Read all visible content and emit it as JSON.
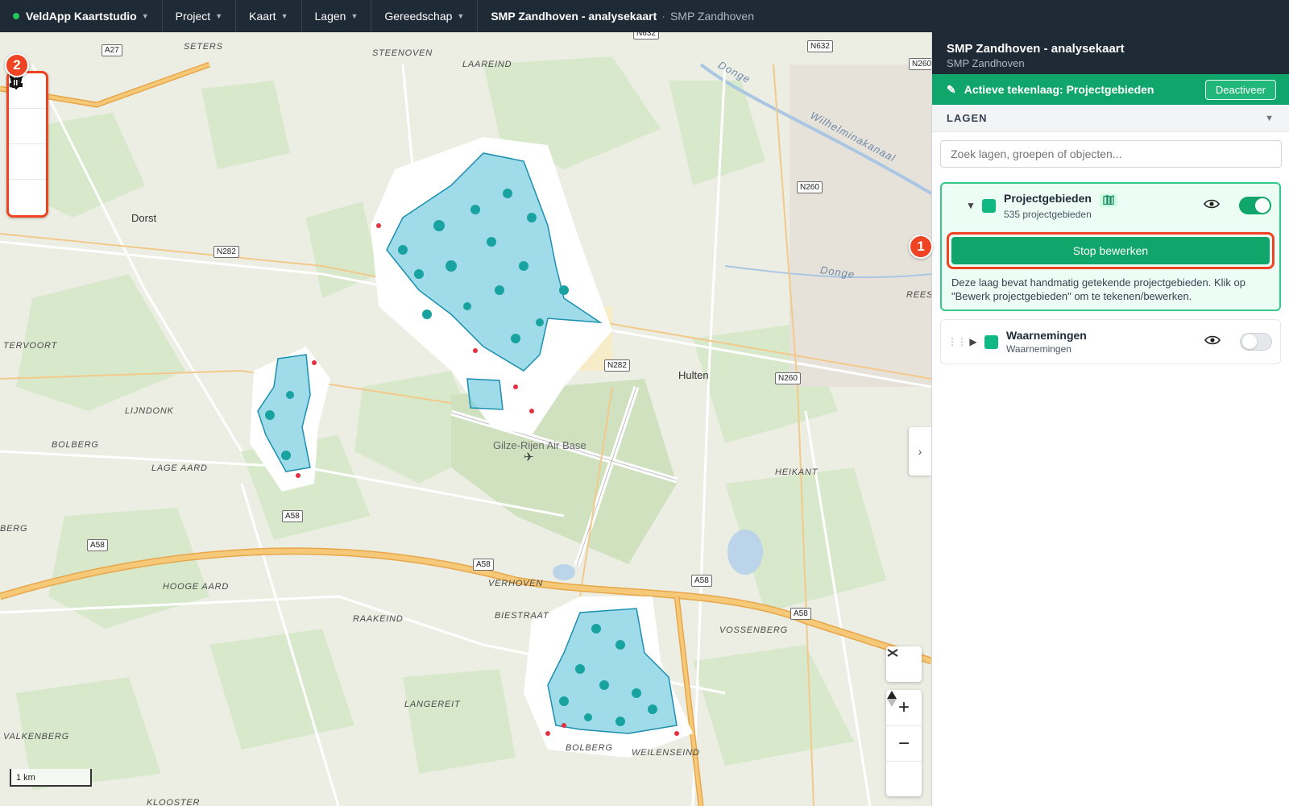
{
  "topbar": {
    "brand": "VeldApp Kaartstudio",
    "menus": [
      "Project",
      "Kaart",
      "Lagen",
      "Gereedschap"
    ],
    "crumb_title": "SMP Zandhoven - analysekaart",
    "crumb_sep": "·",
    "crumb_sub": "SMP Zandhoven"
  },
  "map": {
    "labels": {
      "seters": "SETERS",
      "steenoven": "STEENOVEN",
      "laareind": "LAAREIND",
      "dorst": "Dorst",
      "tervoort": "TERVOORT",
      "lijndonk": "LIJNDONK",
      "bolberg_w": "BOLBERG",
      "lage_aard": "LAGE AARD",
      "berg": "BERG",
      "hooge_aard": "HOOGE AARD",
      "raakeind": "RAAKEIND",
      "verhoven": "VERHOVEN",
      "biestraat": "BIESTRAAT",
      "langereit": "LANGEREIT",
      "valkenberg": "VALKENBERG",
      "klooster": "KLOOSTER",
      "bolberg_s": "BOLBERG",
      "weilenseind": "WEILENSEIND",
      "hulten": "Hulten",
      "heikant": "HEIKANT",
      "vossenberg": "VOSSENBERG",
      "reesi": "REESI",
      "airbase": "Gilze-Rijen Air Base",
      "donge1": "Donge",
      "donge2": "Donge",
      "wilhelmina": "Wilhelminakanaal"
    },
    "shields": {
      "a27": "A27",
      "n632a": "N632",
      "n632b": "N632",
      "n260a": "N260",
      "n260b": "N260",
      "n260c": "N260",
      "n282a": "N282",
      "n282b": "N282",
      "a58a": "A58",
      "a58b": "A58",
      "a58c": "A58",
      "a58d": "A58",
      "a58e": "A58"
    },
    "scale": "1 km",
    "collapse_icon": "chevron-right-icon"
  },
  "draw_toolbar": {
    "badge": "2",
    "tools": [
      "line-tool-icon",
      "polygon-tool-icon",
      "point-tool-icon",
      "trash-icon"
    ]
  },
  "map_controls": {
    "compass": "compass-icon",
    "zoom_in": "+",
    "zoom_out": "−",
    "north": "north-arrow-icon"
  },
  "panel": {
    "title": "SMP Zandhoven - analysekaart",
    "subtitle": "SMP Zandhoven",
    "active_layer": "Actieve tekenlaag: Projectgebieden",
    "deactivate": "Deactiveer",
    "section": "LAGEN",
    "search_placeholder": "Zoek lagen, groepen of objecten...",
    "layers": [
      {
        "name": "Projectgebieden",
        "sub": "535 projectgebieden",
        "visible": true,
        "color": "#10b981",
        "action": "Stop bewerken",
        "badge": "1",
        "description": "Deze laag bevat handmatig getekende projectgebieden. Klik op \"Bewerk projectgebieden\" om te tekenen/bewerken."
      },
      {
        "name": "Waarnemingen",
        "sub": "Waarnemingen",
        "visible": false,
        "color": "#10b981"
      }
    ]
  }
}
